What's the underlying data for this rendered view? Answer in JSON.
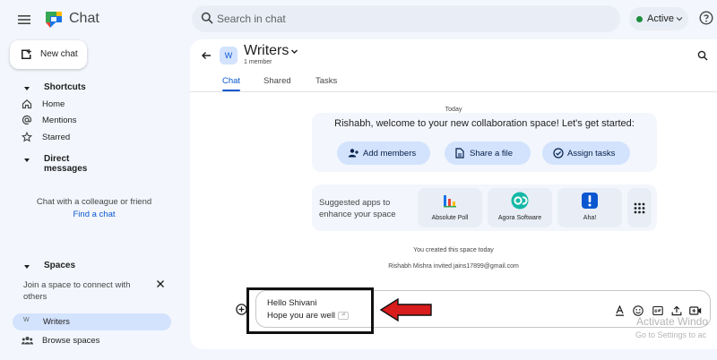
{
  "app": {
    "title": "Chat",
    "search_placeholder": "Search in chat",
    "status": "Active",
    "accent": "#0b57d0"
  },
  "sidebar": {
    "new_chat": "New chat",
    "shortcuts_header": "Shortcuts",
    "shortcuts": [
      {
        "label": "Home",
        "icon": "home-icon"
      },
      {
        "label": "Mentions",
        "icon": "at-sign-icon"
      },
      {
        "label": "Starred",
        "icon": "star-icon"
      }
    ],
    "dm_header": "Direct messages",
    "dm_empty_text": "Chat with a colleague or friend",
    "dm_link": "Find a chat",
    "spaces_header": "Spaces",
    "spaces_note": "Join a space to connect with others",
    "spaces": [
      {
        "badge": "W",
        "label": "Writers",
        "selected": true
      }
    ],
    "browse_spaces": "Browse spaces"
  },
  "space": {
    "avatar": "W",
    "name": "Writers",
    "members": "1 member",
    "tabs": [
      "Chat",
      "Shared",
      "Tasks"
    ],
    "active_tab": "Chat"
  },
  "conversation": {
    "day_label": "Today",
    "welcome_text": "Rishabh, welcome to your new collaboration space! Let's get started:",
    "actions": [
      {
        "label": "Add members",
        "icon": "add-person-icon"
      },
      {
        "label": "Share a file",
        "icon": "file-icon"
      },
      {
        "label": "Assign tasks",
        "icon": "task-icon"
      }
    ],
    "apps_prompt": "Suggested apps to enhance your space",
    "apps": [
      {
        "label": "Absolute Poll",
        "icon": "poll-icon"
      },
      {
        "label": "Agora Software",
        "icon": "agora-icon"
      },
      {
        "label": "Aha!",
        "icon": "aha-icon"
      }
    ],
    "system_messages": [
      "You created this space today",
      "Rishabh Mishra invited jains17899@gmail.com"
    ]
  },
  "composer": {
    "line1": "Hello Shivani",
    "line2": "Hope you are well",
    "enter_hint": "⏎",
    "tools": [
      "format-text-icon",
      "emoji-icon",
      "gif-icon",
      "upload-icon",
      "video-call-icon"
    ]
  },
  "watermark": {
    "line1": "Activate Windo",
    "line2": "Go to Settings to ac"
  },
  "annotation_color": "#d91c1c"
}
